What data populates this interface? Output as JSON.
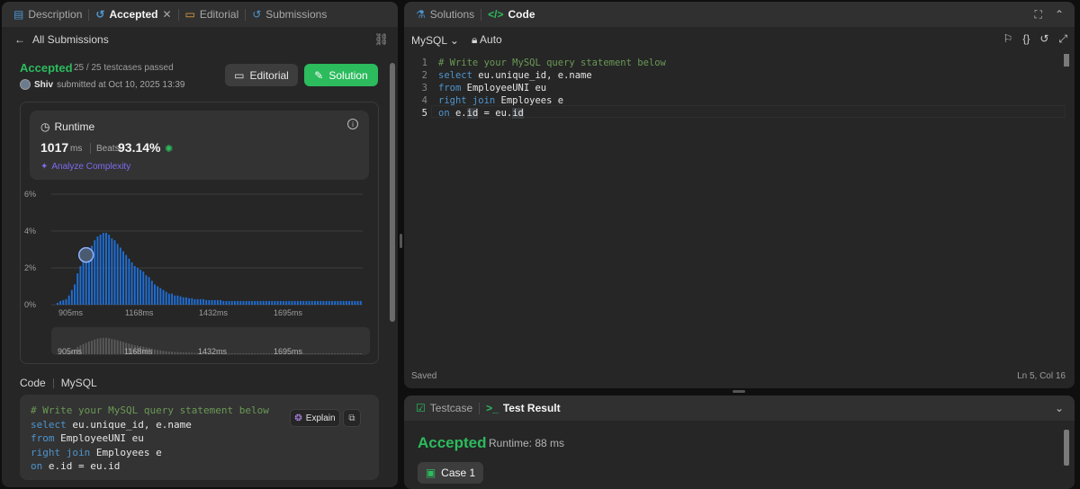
{
  "left_tabs": [
    "Description",
    "Accepted",
    "Editorial",
    "Submissions"
  ],
  "all_submissions": "All Submissions",
  "status": {
    "title": "Accepted",
    "testcases": "25 / 25 testcases passed",
    "user": "Shiv",
    "submitted": "submitted at Oct 10, 2025 13:39"
  },
  "buttons": {
    "editorial": "Editorial",
    "solution": "Solution"
  },
  "runtime": {
    "label": "Runtime",
    "value": "1017",
    "unit": "ms",
    "beats_label": "Beats",
    "beats_value": "93.14%",
    "analyze": "Analyze Complexity"
  },
  "chart_data": {
    "type": "bar",
    "y_ticks": [
      "6%",
      "4%",
      "2%",
      "0%"
    ],
    "ylim": [
      0,
      6
    ],
    "x_tick_labels": [
      "905ms",
      "1168ms",
      "1432ms",
      "1695ms"
    ],
    "values": [
      0.1,
      0.2,
      0.25,
      0.3,
      0.5,
      0.8,
      1.1,
      1.7,
      2.1,
      2.4,
      2.7,
      3.0,
      3.2,
      3.5,
      3.7,
      3.8,
      3.9,
      3.9,
      3.8,
      3.6,
      3.5,
      3.3,
      3.1,
      2.9,
      2.7,
      2.5,
      2.3,
      2.1,
      2.0,
      1.9,
      1.8,
      1.6,
      1.5,
      1.3,
      1.1,
      1.0,
      0.9,
      0.8,
      0.7,
      0.6,
      0.6,
      0.5,
      0.5,
      0.45,
      0.4,
      0.4,
      0.35,
      0.35,
      0.3,
      0.3,
      0.3,
      0.3,
      0.25,
      0.25,
      0.25,
      0.25,
      0.25,
      0.25,
      0.2,
      0.2,
      0.2,
      0.2,
      0.2,
      0.2,
      0.2,
      0.2,
      0.2,
      0.2,
      0.2,
      0.2,
      0.2,
      0.2,
      0.2,
      0.2,
      0.2,
      0.2,
      0.2,
      0.2,
      0.2,
      0.2,
      0.2,
      0.2,
      0.2,
      0.2,
      0.2,
      0.2,
      0.2,
      0.2,
      0.2,
      0.2,
      0.2,
      0.2,
      0.2,
      0.2,
      0.2,
      0.2,
      0.2,
      0.2,
      0.2,
      0.2,
      0.2,
      0.2,
      0.2,
      0.2,
      0.2,
      0.2,
      0.2
    ],
    "marker_index": 10,
    "bar_color": "#1e6fd9"
  },
  "code_section": {
    "label": "Code",
    "lang": "MySQL",
    "explain": "Explain"
  },
  "code_lines": [
    "# Write your MySQL query statement below",
    "select eu.unique_id, e.name",
    "from EmployeeUNI eu",
    "right join Employees e",
    "on e.id = eu.id"
  ],
  "right_tabs": [
    "Solutions",
    "Code"
  ],
  "editor": {
    "lang": "MySQL",
    "mode": "Auto",
    "saved": "Saved",
    "position": "Ln 5, Col 16"
  },
  "result_tabs": [
    "Testcase",
    "Test Result"
  ],
  "result": {
    "title": "Accepted",
    "runtime": "Runtime: 88 ms",
    "case": "Case 1"
  },
  "colors": {
    "accent_green": "#2cbb5d",
    "keyword_blue": "#4e94ce",
    "comment_green": "#6a9955"
  }
}
